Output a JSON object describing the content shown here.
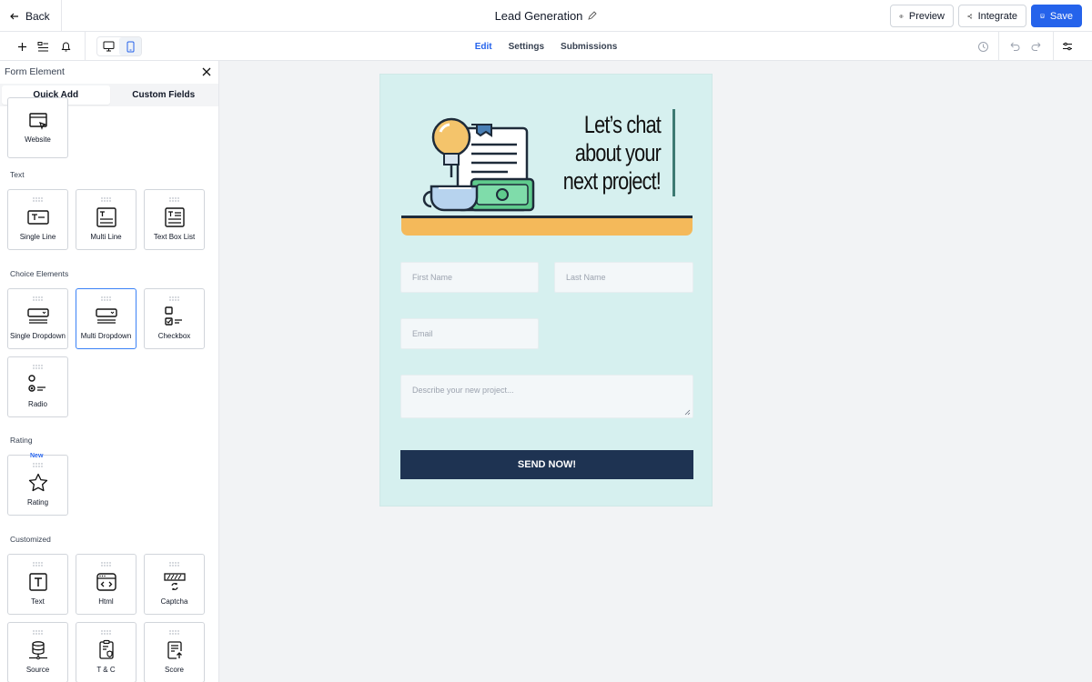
{
  "header": {
    "back_label": "Back",
    "title": "Lead Generation",
    "preview_label": "Preview",
    "integrate_label": "Integrate",
    "save_label": "Save"
  },
  "toolbar": {
    "tabs": [
      {
        "label": "Edit",
        "active": true
      },
      {
        "label": "Settings",
        "active": false
      },
      {
        "label": "Submissions",
        "active": false
      }
    ],
    "active_device": "mobile"
  },
  "sidebar": {
    "title": "Form Element",
    "tabs": [
      {
        "label": "Quick Add",
        "active": true
      },
      {
        "label": "Custom Fields",
        "active": false
      }
    ],
    "sections": [
      {
        "title": "",
        "items": [
          {
            "label": "Website",
            "icon": "website-icon"
          }
        ]
      },
      {
        "title": "Text",
        "items": [
          {
            "label": "Single Line",
            "icon": "single-line-icon"
          },
          {
            "label": "Multi Line",
            "icon": "multi-line-icon"
          },
          {
            "label": "Text Box List",
            "icon": "text-box-list-icon"
          }
        ]
      },
      {
        "title": "Choice Elements",
        "items": [
          {
            "label": "Single Dropdown",
            "icon": "single-dropdown-icon"
          },
          {
            "label": "Multi Dropdown",
            "icon": "multi-dropdown-icon",
            "selected": true
          },
          {
            "label": "Checkbox",
            "icon": "checkbox-icon"
          },
          {
            "label": "Radio",
            "icon": "radio-icon"
          }
        ]
      },
      {
        "title": "Rating",
        "items": [
          {
            "label": "Rating",
            "icon": "star-icon",
            "badge": "New"
          }
        ]
      },
      {
        "title": "Customized",
        "items": [
          {
            "label": "Text",
            "icon": "text-icon"
          },
          {
            "label": "Html",
            "icon": "html-icon"
          },
          {
            "label": "Captcha",
            "icon": "captcha-icon"
          },
          {
            "label": "Source",
            "icon": "source-icon"
          },
          {
            "label": "T & C",
            "icon": "terms-icon"
          },
          {
            "label": "Score",
            "icon": "score-icon"
          }
        ]
      }
    ]
  },
  "form": {
    "hero_line1": "Let’s chat",
    "hero_line2": "about your",
    "hero_line3": "next project!",
    "first_name_placeholder": "First Name",
    "last_name_placeholder": "Last Name",
    "email_placeholder": "Email",
    "description_placeholder": "Describe your new project...",
    "submit_label": "SEND NOW!"
  },
  "colors": {
    "accent": "#2563eb",
    "form_background": "#d6f0ef",
    "shelf": "#f4b95a",
    "submit_button": "#1e3352"
  }
}
